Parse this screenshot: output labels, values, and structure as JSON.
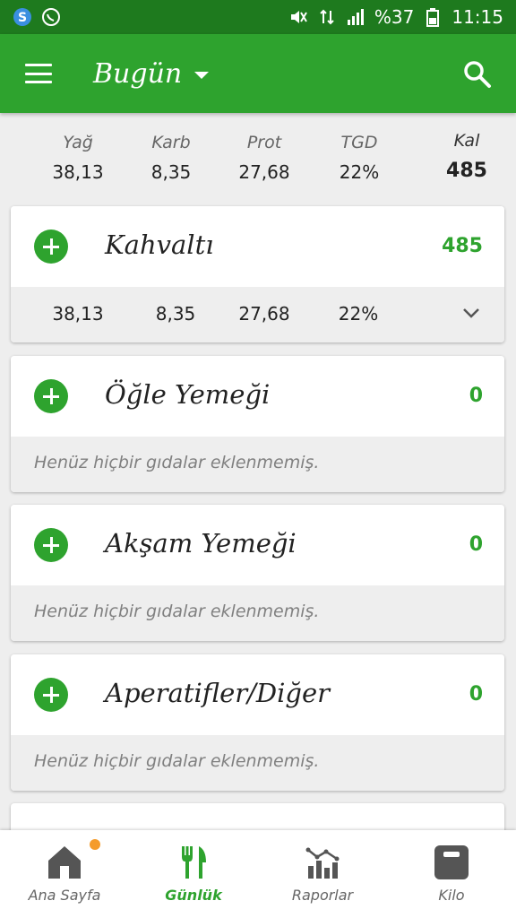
{
  "status_bar": {
    "battery_percent": "%37",
    "time": "11:15",
    "icons": [
      "skype-icon",
      "whatsapp-icon",
      "mute-icon",
      "data-icon",
      "signal-icon",
      "battery-icon"
    ]
  },
  "app_bar": {
    "title": "Bugün",
    "icons": [
      "menu-icon",
      "dropdown-icon",
      "search-icon"
    ]
  },
  "summary": {
    "labels": [
      "Yağ",
      "Karb",
      "Prot",
      "TGD",
      "Kal"
    ],
    "values": [
      "38,13",
      "8,35",
      "27,68",
      "22%",
      "485"
    ]
  },
  "meals": [
    {
      "name": "Kahvaltı",
      "kcal": "485",
      "macros": [
        "38,13",
        "8,35",
        "27,68",
        "22%"
      ],
      "empty_text": ""
    },
    {
      "name": "Öğle Yemeği",
      "kcal": "0",
      "empty_text": "Henüz hiçbir gıdalar eklenmemiş."
    },
    {
      "name": "Akşam Yemeği",
      "kcal": "0",
      "empty_text": "Henüz hiçbir gıdalar eklenmemiş."
    },
    {
      "name": "Aperatifler/Diğer",
      "kcal": "0",
      "empty_text": "Henüz hiçbir gıdalar eklenmemiş."
    }
  ],
  "bottom_nav": [
    {
      "label": "Ana Sayfa",
      "icon": "home-icon",
      "active": false
    },
    {
      "label": "Günlük",
      "icon": "fork-knife-icon",
      "active": true
    },
    {
      "label": "Raporlar",
      "icon": "reports-icon",
      "active": false
    },
    {
      "label": "Kilo",
      "icon": "scale-icon",
      "active": false
    }
  ],
  "colors": {
    "primary": "#2ea32e",
    "status_bar": "#1e7a1e",
    "badge": "#f59b2a"
  }
}
